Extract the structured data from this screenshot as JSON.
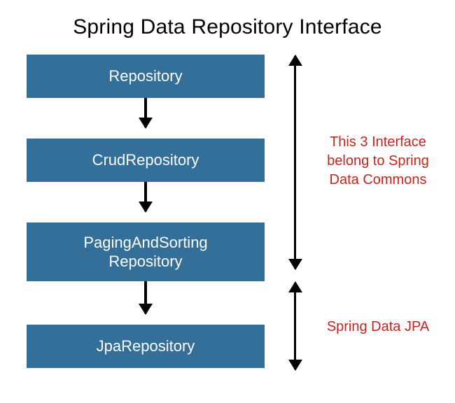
{
  "title": "Spring Data Repository Interface",
  "boxes": {
    "repository": "Repository",
    "crud": "CrudRepository",
    "paging": "PagingAndSorting\nRepository",
    "jpa": "JpaRepository"
  },
  "annotations": {
    "commons": "This 3 Interface belong to Spring Data Commons",
    "jpa": "Spring Data JPA"
  },
  "colors": {
    "box_bg": "#336f98",
    "annotation_text": "#c4251c"
  }
}
